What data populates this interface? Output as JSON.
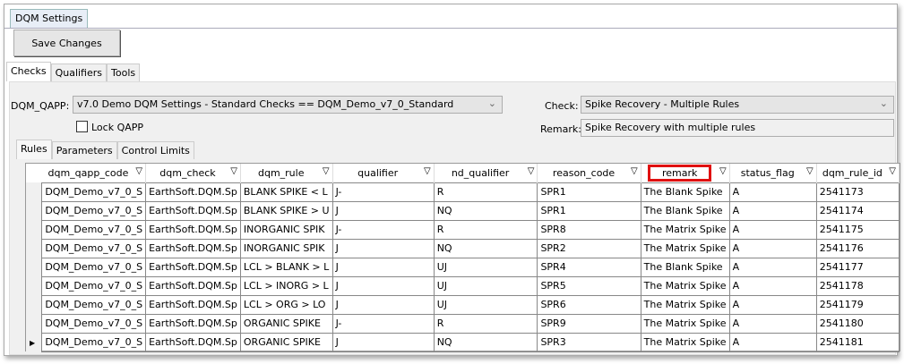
{
  "window": {
    "doc_tab": "DQM Settings"
  },
  "toolbar": {
    "save_label": "Save Changes"
  },
  "tabs": [
    "Checks",
    "Qualifiers",
    "Tools"
  ],
  "checks": {
    "qapp_label": "DQM_QAPP:",
    "qapp_value": "v7.0 Demo DQM Settings - Standard Checks  ==  DQM_Demo_v7_0_Standard",
    "lock_label": "Lock QAPP",
    "check_label": "Check:",
    "check_value": "Spike Recovery - Multiple Rules",
    "remark_label": "Remark:",
    "remark_value": "Spike Recovery with multiple rules"
  },
  "subtabs": [
    "Rules",
    "Parameters",
    "Control Limits"
  ],
  "grid": {
    "columns": [
      "dqm_qapp_code",
      "dqm_check",
      "dqm_rule",
      "qualifier",
      "nd_qualifier",
      "reason_code",
      "remark",
      "status_flag",
      "dqm_rule_id"
    ],
    "rows": [
      [
        "DQM_Demo_v7_0_S",
        "EarthSoft.DQM.Sp",
        "BLANK SPIKE < L",
        "J-",
        "R",
        "SPR1",
        "The Blank Spike",
        "A",
        "2541173"
      ],
      [
        "DQM_Demo_v7_0_S",
        "EarthSoft.DQM.Sp",
        "BLANK SPIKE > U",
        "J",
        "NQ",
        "SPR1",
        "The Blank Spike",
        "A",
        "2541174"
      ],
      [
        "DQM_Demo_v7_0_S",
        "EarthSoft.DQM.Sp",
        "INORGANIC SPIK",
        "J-",
        "R",
        "SPR8",
        "The Matrix Spike",
        "A",
        "2541175"
      ],
      [
        "DQM_Demo_v7_0_S",
        "EarthSoft.DQM.Sp",
        "INORGANIC SPIK",
        "J",
        "NQ",
        "SPR2",
        "The Matrix Spike",
        "A",
        "2541176"
      ],
      [
        "DQM_Demo_v7_0_S",
        "EarthSoft.DQM.Sp",
        "LCL > BLANK > L",
        "J",
        "UJ",
        "SPR4",
        "The Blank Spike",
        "A",
        "2541177"
      ],
      [
        "DQM_Demo_v7_0_S",
        "EarthSoft.DQM.Sp",
        "LCL > INORG > L",
        "J",
        "UJ",
        "SPR5",
        "The Matrix Spike",
        "A",
        "2541178"
      ],
      [
        "DQM_Demo_v7_0_S",
        "EarthSoft.DQM.Sp",
        "LCL > ORG > LO",
        "J",
        "UJ",
        "SPR6",
        "The Matrix Spike",
        "A",
        "2541179"
      ],
      [
        "DQM_Demo_v7_0_S",
        "EarthSoft.DQM.Sp",
        "ORGANIC SPIKE",
        "J-",
        "R",
        "SPR9",
        "The Matrix Spike",
        "A",
        "2541180"
      ],
      [
        "DQM_Demo_v7_0_S",
        "EarthSoft.DQM.Sp",
        "ORGANIC SPIKE",
        "J",
        "NQ",
        "SPR3",
        "The Matrix Spike",
        "A",
        "2541181"
      ]
    ],
    "current_row": 8,
    "highlight_color": "#e01010"
  }
}
